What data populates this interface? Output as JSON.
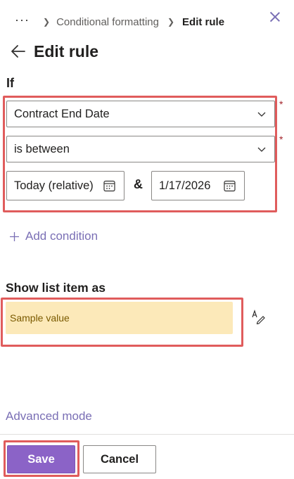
{
  "breadcrumb": {
    "more": "···",
    "parent": "Conditional formatting",
    "current": "Edit rule"
  },
  "panel": {
    "title": "Edit rule"
  },
  "condition": {
    "if_label": "If",
    "field_value": "Contract End Date",
    "operator_value": "is between",
    "required_marker": "*",
    "date_from": "Today (relative)",
    "range_separator": "&",
    "date_to": "1/17/2026",
    "add_condition_label": "Add condition"
  },
  "display": {
    "section_label": "Show list item as",
    "sample_text": "Sample value"
  },
  "advanced_mode_label": "Advanced mode",
  "footer": {
    "save_label": "Save",
    "cancel_label": "Cancel"
  },
  "colors": {
    "accent": "#7a6fb5",
    "save_button": "#8b63c7",
    "highlight": "#e05c5c",
    "sample_background": "#fce9b9"
  },
  "icons": [
    "close-icon",
    "back-arrow-icon",
    "chevron-down-icon",
    "calendar-icon",
    "plus-icon",
    "format-pen-icon"
  ]
}
